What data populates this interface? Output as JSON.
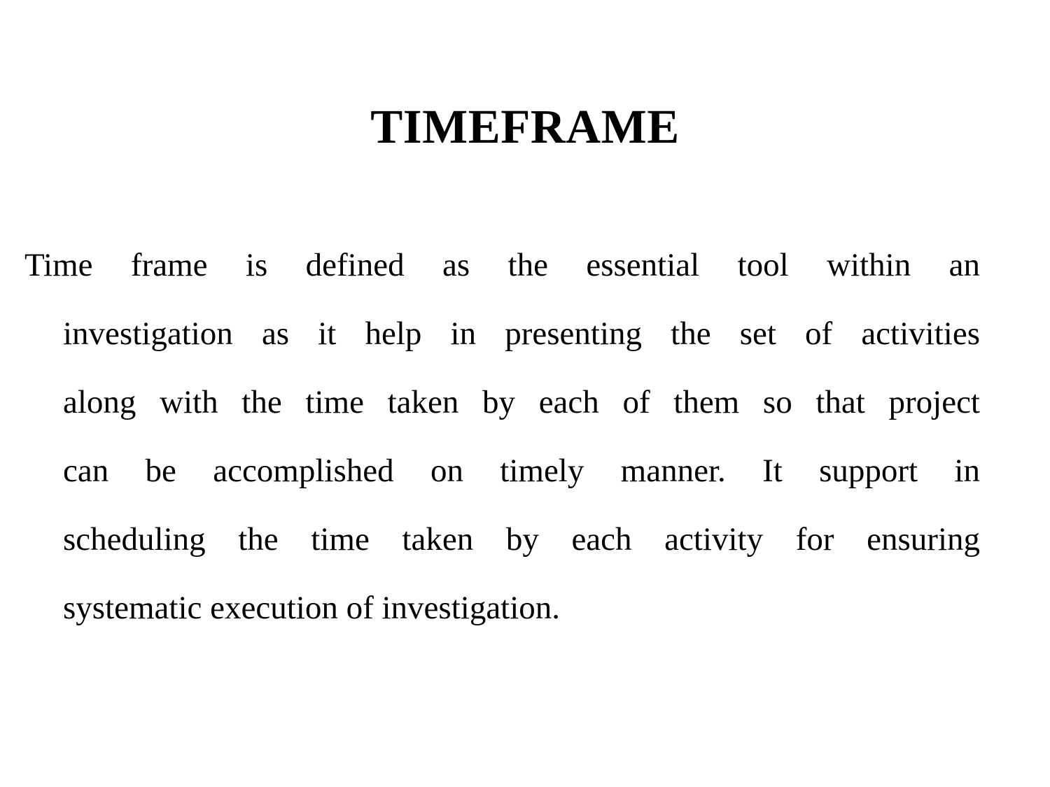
{
  "document": {
    "type": "presentation-slide",
    "background_color": "#ffffff",
    "text_color": "#000000"
  },
  "slide": {
    "title": "TIMEFRAME",
    "body_paragraph": "Time frame is defined as the essential tool within an investigation as it help in presenting the set of activities along with the time taken by each of them so that project can be accomplished on timely manner. It support in scheduling the time taken by each activity for ensuring systematic execution of investigation.",
    "body_lines": [
      "Time frame is defined as the essential tool within an",
      "investigation as it help in presenting the set of activities",
      "along with the time taken by each of them so that project",
      "can be accomplished on timely manner. It support in",
      "scheduling the time taken by each activity for ensuring",
      "systematic execution of investigation."
    ]
  }
}
